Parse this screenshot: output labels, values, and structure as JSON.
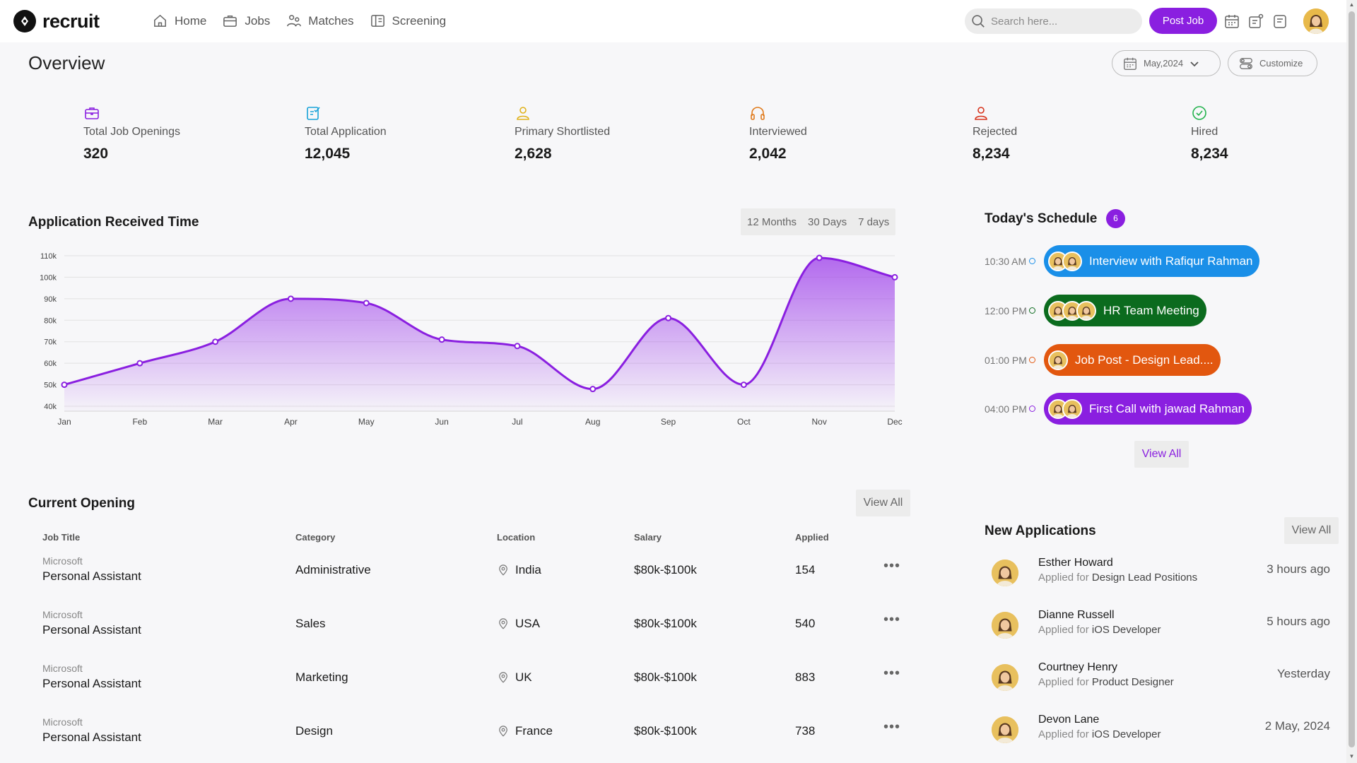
{
  "brand": {
    "name": "recruit"
  },
  "nav": [
    {
      "label": "Home",
      "icon": "home-icon"
    },
    {
      "label": "Jobs",
      "icon": "briefcase-icon"
    },
    {
      "label": "Matches",
      "icon": "users-icon"
    },
    {
      "label": "Screening",
      "icon": "screen-icon"
    }
  ],
  "search": {
    "placeholder": "Search here..."
  },
  "header": {
    "post_job_label": "Post Job"
  },
  "overview": {
    "title": "Overview",
    "month_label": "May,2024",
    "customize_label": "Customize"
  },
  "stats": [
    {
      "label": "Total Job Openings",
      "value": "320",
      "color": "#8a1fe0"
    },
    {
      "label": "Total Application",
      "value": "12,045",
      "color": "#17a2d8"
    },
    {
      "label": "Primary Shortlisted",
      "value": "2,628",
      "color": "#e0b21b"
    },
    {
      "label": "Interviewed",
      "value": "2,042",
      "color": "#e07a1b"
    },
    {
      "label": "Rejected",
      "value": "8,234",
      "color": "#d7331c"
    },
    {
      "label": "Hired",
      "value": "8,234",
      "color": "#22b24c"
    }
  ],
  "chart_section": {
    "title": "Application Received Time",
    "ranges": [
      "12 Months",
      "30 Days",
      "7 days"
    ]
  },
  "chart_data": {
    "type": "area",
    "categories": [
      "Jan",
      "Feb",
      "Mar",
      "Apr",
      "May",
      "Jun",
      "Jul",
      "Aug",
      "Sep",
      "Oct",
      "Nov",
      "Dec"
    ],
    "values": [
      50000,
      60000,
      70000,
      90000,
      88000,
      71000,
      68000,
      48000,
      81000,
      50000,
      109000,
      100000
    ],
    "y_ticks": [
      "40k",
      "50k",
      "60k",
      "70k",
      "80k",
      "90k",
      "100k",
      "110k"
    ],
    "ylim": [
      40000,
      110000
    ],
    "grid": true,
    "color": "#8a1fe0"
  },
  "schedule": {
    "title": "Today's Schedule",
    "count": "6",
    "items": [
      {
        "time": "10:30 AM",
        "label": "Interview with Rafiqur Rahman",
        "color": "#1a8fe8",
        "avatars": 2
      },
      {
        "time": "12:00 PM",
        "label": "HR Team Meeting",
        "color": "#0b6b1e",
        "avatars": 3
      },
      {
        "time": "01:00 PM",
        "label": "Job Post - Design Lead....",
        "color": "#e2570f",
        "avatars": 1
      },
      {
        "time": "04:00 PM",
        "label": "First Call with jawad Rahman",
        "color": "#8a1fe0",
        "avatars": 2
      }
    ],
    "view_all": "View All"
  },
  "openings": {
    "title": "Current Opening",
    "view_all": "View All",
    "columns": [
      "Job Title",
      "Category",
      "Location",
      "Salary",
      "Applied"
    ],
    "rows": [
      {
        "company": "Microsoft",
        "title": "Personal Assistant",
        "category": "Administrative",
        "location": "India",
        "salary": "$80k-$100k",
        "applied": "154"
      },
      {
        "company": "Microsoft",
        "title": "Personal Assistant",
        "category": "Sales",
        "location": "USA",
        "salary": "$80k-$100k",
        "applied": "540"
      },
      {
        "company": "Microsoft",
        "title": "Personal Assistant",
        "category": "Marketing",
        "location": "UK",
        "salary": "$80k-$100k",
        "applied": "883"
      },
      {
        "company": "Microsoft",
        "title": "Personal Assistant",
        "category": "Design",
        "location": "France",
        "salary": "$80k-$100k",
        "applied": "738"
      }
    ]
  },
  "applications": {
    "title": "New Applications",
    "view_all": "View All",
    "applied_prefix": "Applied for",
    "items": [
      {
        "name": "Esther Howard",
        "role": "Design Lead Positions",
        "time": "3 hours ago"
      },
      {
        "name": "Dianne Russell",
        "role": "iOS Developer",
        "time": "5 hours ago"
      },
      {
        "name": "Courtney Henry",
        "role": "Product Designer",
        "time": "Yesterday"
      },
      {
        "name": "Devon Lane",
        "role": "iOS Developer",
        "time": "2 May, 2024"
      }
    ]
  }
}
